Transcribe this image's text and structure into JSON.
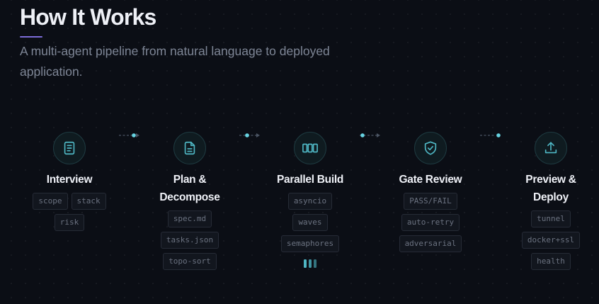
{
  "header": {
    "title": "How It Works",
    "subtitle": "A multi-agent pipeline from natural language to deployed application."
  },
  "pipeline": {
    "steps": [
      {
        "name": "Interview",
        "icon": "document-icon",
        "tags": [
          "scope",
          "stack",
          "risk"
        ]
      },
      {
        "name": "Plan & Decompose",
        "icon": "file-list-icon",
        "tags": [
          "spec.md",
          "tasks.json",
          "topo-sort"
        ]
      },
      {
        "name": "Parallel Build",
        "icon": "columns-icon",
        "tags": [
          "asyncio",
          "waves",
          "semaphores"
        ]
      },
      {
        "name": "Gate Review",
        "icon": "shield-check-icon",
        "tags": [
          "PASS/FAIL",
          "auto-retry",
          "adversarial"
        ]
      },
      {
        "name": "Preview & Deploy",
        "icon": "upload-icon",
        "tags": [
          "tunnel",
          "docker+ssl",
          "health"
        ]
      }
    ]
  },
  "colors": {
    "background": "#0b0e15",
    "accent_bar": "#7c6cd8",
    "cyan": "#4fb7c4",
    "icon_circle_bg": "#0f1b20"
  }
}
